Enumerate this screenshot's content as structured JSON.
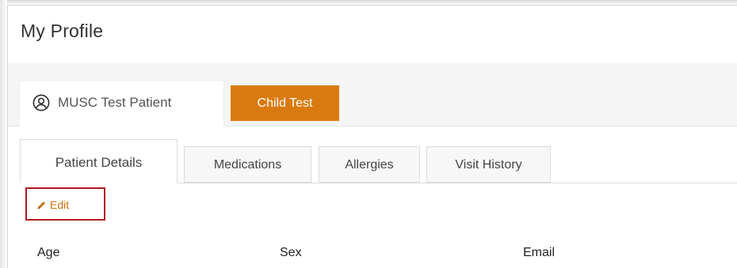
{
  "page": {
    "title": "My Profile"
  },
  "patients": {
    "active": {
      "name": "MUSC Test Patient",
      "icon": "user-circle-icon"
    },
    "other": {
      "name": "Child Test",
      "color": "#d97a0f"
    }
  },
  "detail_tabs": [
    {
      "label": "Patient Details",
      "active": true
    },
    {
      "label": "Medications",
      "active": false
    },
    {
      "label": "Allergies",
      "active": false
    },
    {
      "label": "Visit History",
      "active": false
    }
  ],
  "actions": {
    "edit_label": "Edit",
    "edit_icon": "pencil-icon",
    "edit_color": "#c9700e",
    "highlight_color": "#b0161e"
  },
  "fields": {
    "age_label": "Age",
    "sex_label": "Sex",
    "email_label": "Email"
  }
}
